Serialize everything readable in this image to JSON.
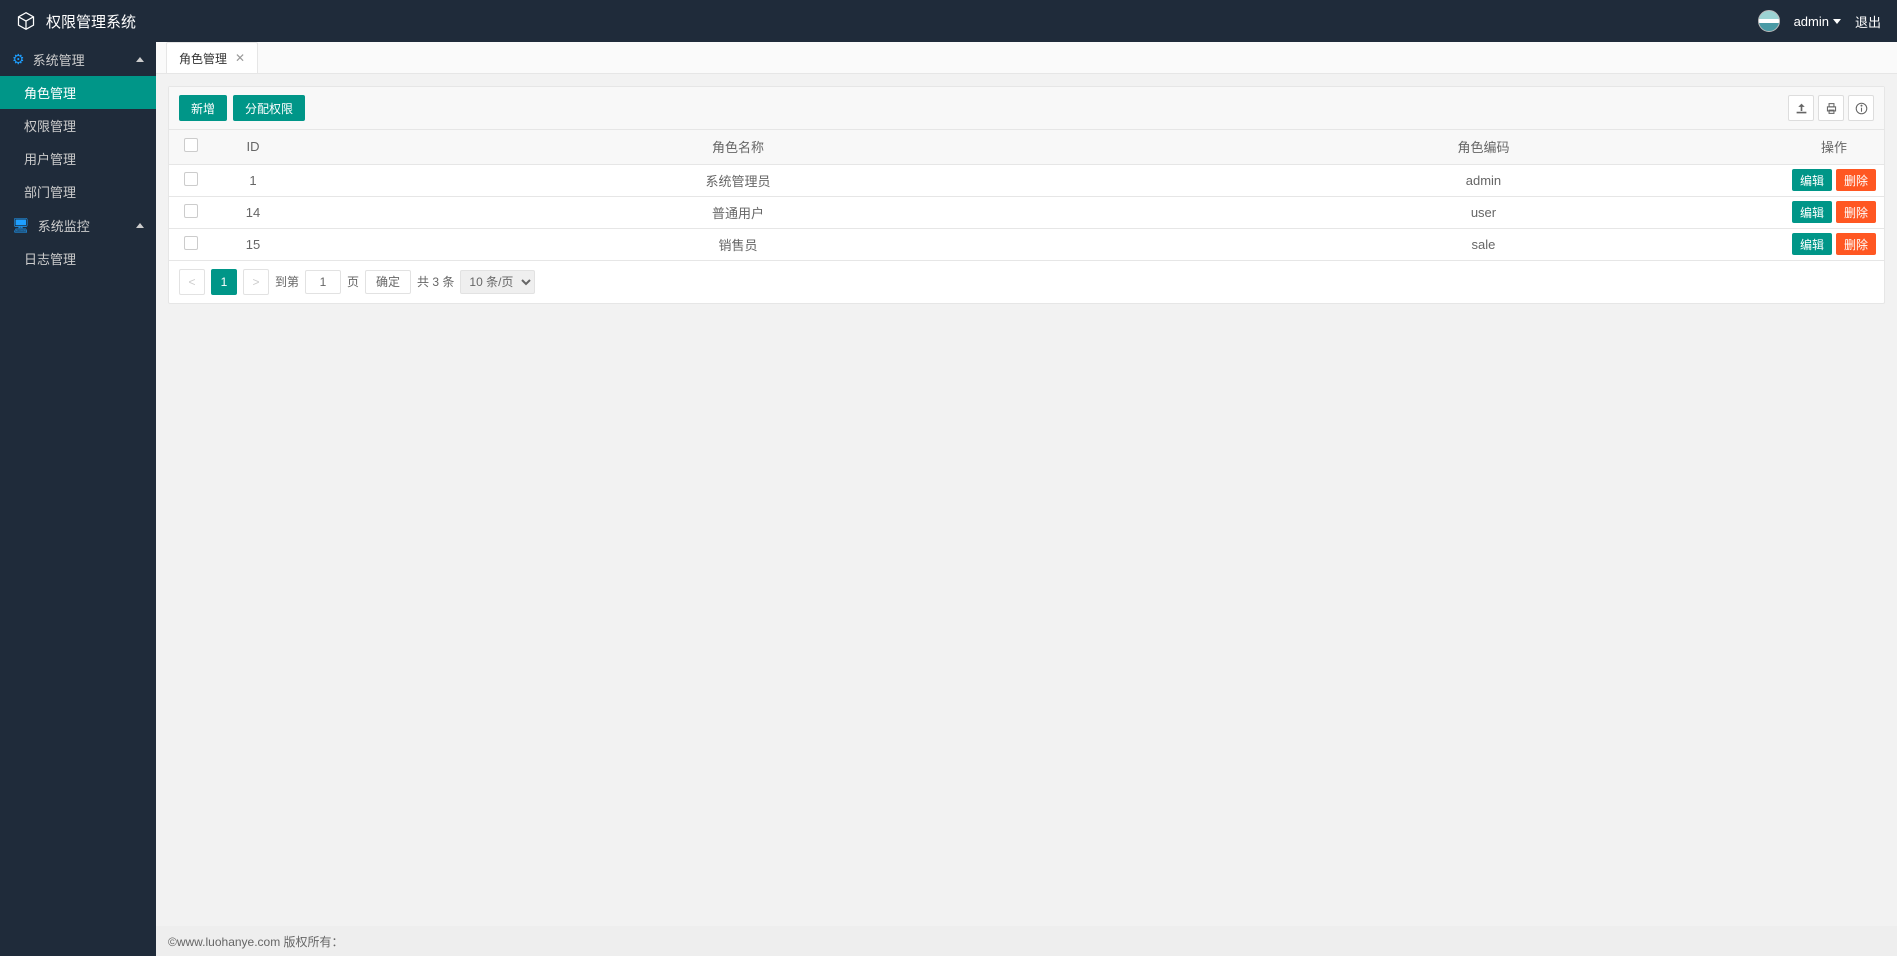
{
  "header": {
    "app_title": "权限管理系统",
    "username": "admin",
    "logout": "退出"
  },
  "sidebar": {
    "groups": [
      {
        "label": "系统管理",
        "items": [
          {
            "label": "角色管理",
            "active": true
          },
          {
            "label": "权限管理",
            "active": false
          },
          {
            "label": "用户管理",
            "active": false
          },
          {
            "label": "部门管理",
            "active": false
          }
        ]
      },
      {
        "label": "系统监控",
        "items": [
          {
            "label": "日志管理",
            "active": false
          }
        ]
      }
    ]
  },
  "tabs": {
    "items": [
      {
        "label": "角色管理"
      }
    ]
  },
  "toolbar": {
    "add_label": "新增",
    "assign_label": "分配权限"
  },
  "table": {
    "columns": {
      "id": "ID",
      "name": "角色名称",
      "code": "角色编码",
      "op": "操作"
    },
    "row_actions": {
      "edit": "编辑",
      "delete": "删除"
    },
    "rows": [
      {
        "id": "1",
        "name": "系统管理员",
        "code": "admin"
      },
      {
        "id": "14",
        "name": "普通用户",
        "code": "user"
      },
      {
        "id": "15",
        "name": "销售员",
        "code": "sale"
      }
    ]
  },
  "pagination": {
    "current_page": "1",
    "goto_prefix": "到第",
    "goto_suffix": "页",
    "goto_value": "1",
    "confirm": "确定",
    "total": "共 3 条",
    "per_page": "10 条/页"
  },
  "footer": {
    "copyright": "©www.luohanye.com 版权所有："
  }
}
